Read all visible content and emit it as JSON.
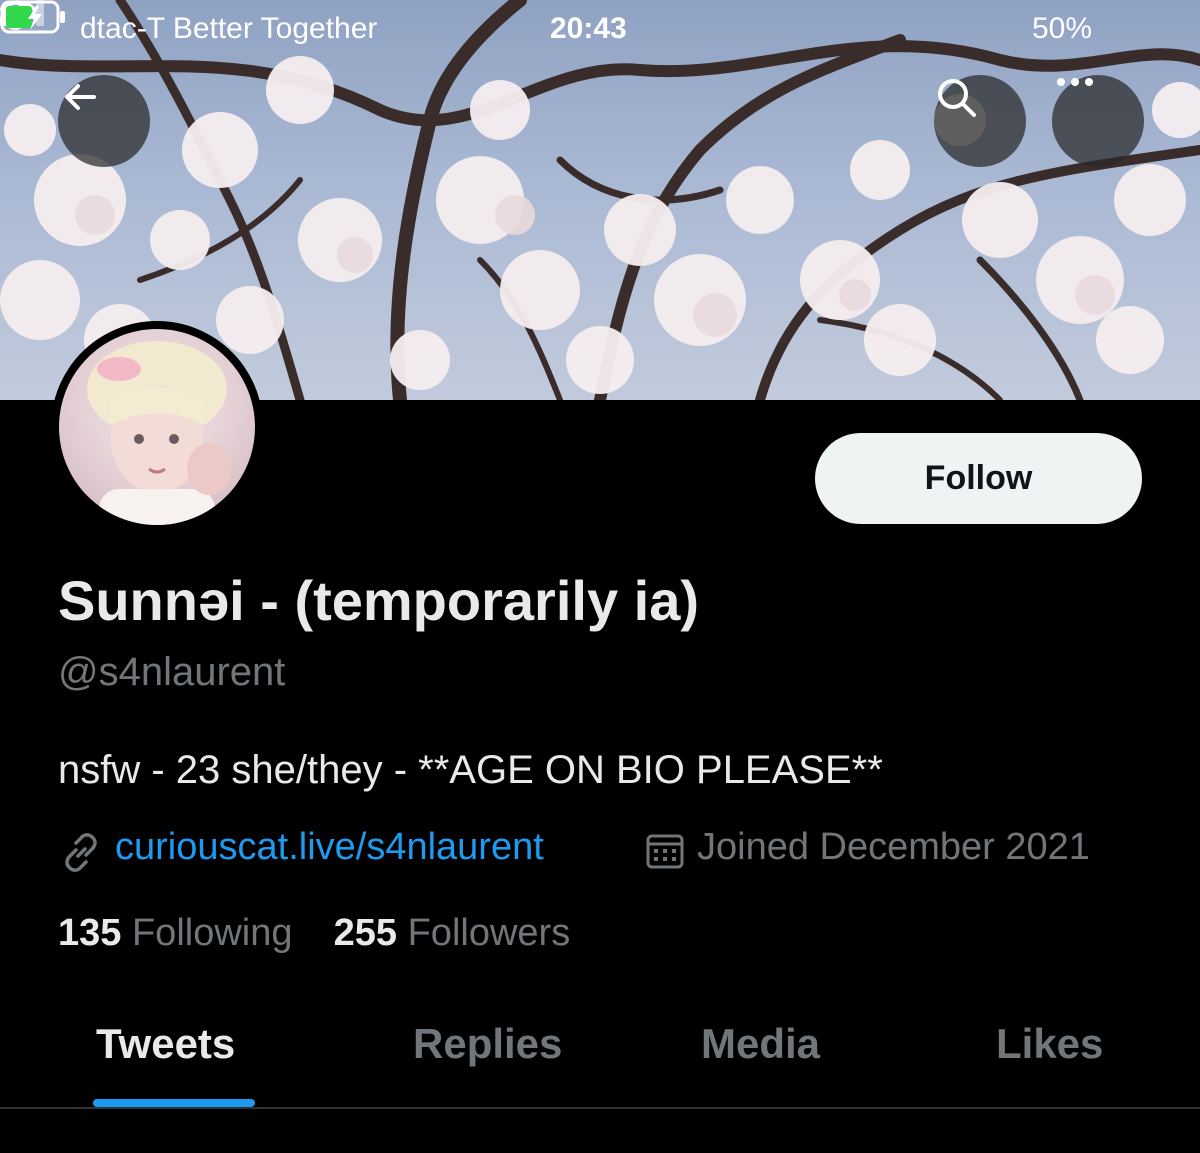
{
  "status_bar": {
    "carrier": "dtac-T Better Together",
    "time": "20:43",
    "battery_pct": "50%"
  },
  "profile": {
    "display_name": "Sunnəi - (temporarily ia)",
    "handle": "@s4nlaurent",
    "bio": "nsfw - 23 she/they - **AGE ON BIO PLEASE**",
    "link": "curiouscat.live/s4nlaurent",
    "joined": "Joined December 2021",
    "following_count": "135",
    "following_label": "Following",
    "followers_count": "255",
    "followers_label": "Followers"
  },
  "actions": {
    "follow_label": "Follow"
  },
  "tabs": [
    {
      "label": "Tweets",
      "active": true
    },
    {
      "label": "Replies",
      "active": false
    },
    {
      "label": "Media",
      "active": false
    },
    {
      "label": "Likes",
      "active": false
    }
  ],
  "colors": {
    "accent": "#1d9bf0",
    "background": "#000000",
    "muted": "#71767b"
  },
  "icons": [
    "back-arrow-icon",
    "search-icon",
    "more-icon",
    "link-icon",
    "calendar-icon",
    "wifi-icon",
    "signal-icon",
    "battery-icon"
  ]
}
